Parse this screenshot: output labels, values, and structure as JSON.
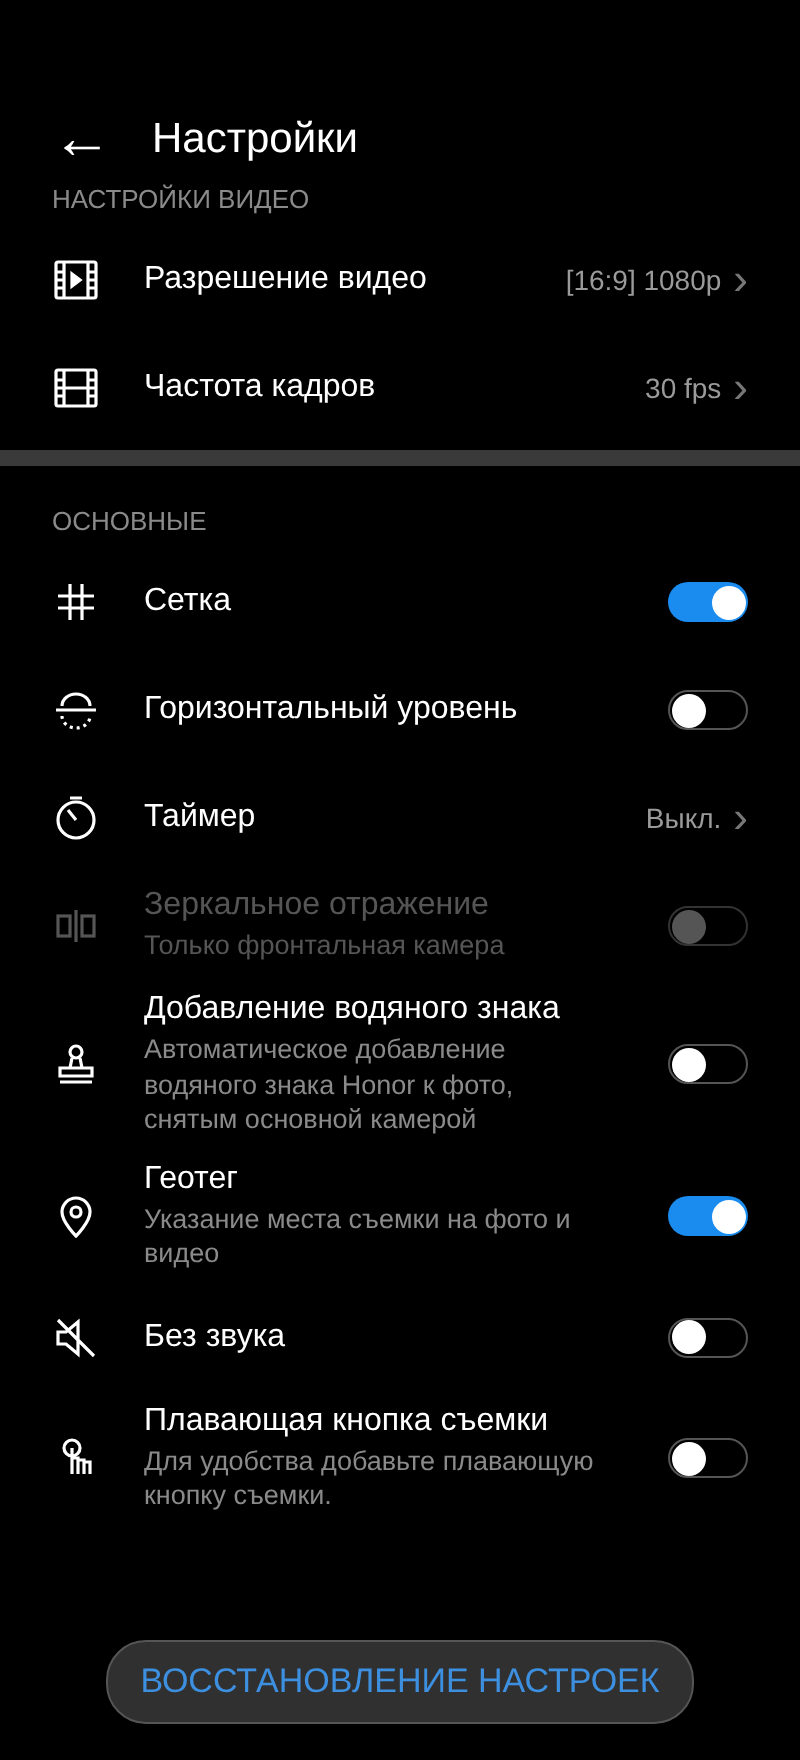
{
  "header": {
    "back": "←",
    "title": "Настройки"
  },
  "sections": [
    {
      "title": "НАСТРОЙКИ ВИДЕО",
      "items": [
        {
          "kind": "link",
          "label": "Разрешение видео",
          "value": "[16:9] 1080p",
          "chevron": "›"
        },
        {
          "kind": "link",
          "label": "Частота кадров",
          "value": "30 fps",
          "chevron": "›"
        }
      ]
    },
    {
      "title": "ОСНОВНЫЕ",
      "items": [
        {
          "kind": "switch",
          "label": "Сетка",
          "on": true,
          "disabled": false
        },
        {
          "kind": "switch",
          "label": "Горизонтальный уровень",
          "on": false,
          "disabled": false
        },
        {
          "kind": "link",
          "label": "Таймер",
          "value": "Выкл.",
          "chevron": "›"
        },
        {
          "kind": "switch",
          "label": "Зеркальное отражение",
          "sub": "Только фронтальная камера",
          "on": false,
          "disabled": true
        },
        {
          "kind": "switch",
          "label": "Добавление водяного знака",
          "sub": "Автоматическое добавление водяного знака Honor к фото, снятым основной камерой",
          "on": false,
          "disabled": false
        },
        {
          "kind": "switch",
          "label": "Геотег",
          "sub": "Указание места съемки на фото и видео",
          "on": true,
          "disabled": false
        },
        {
          "kind": "switch",
          "label": "Без звука",
          "on": false,
          "disabled": false
        },
        {
          "kind": "switch",
          "label": "Плавающая кнопка съемки",
          "sub": "Для удобства добавьте плавающую кнопку съемки.",
          "on": false,
          "disabled": false
        }
      ]
    }
  ],
  "reset_button": "ВОССТАНОВЛЕНИЕ НАСТРОЕК"
}
